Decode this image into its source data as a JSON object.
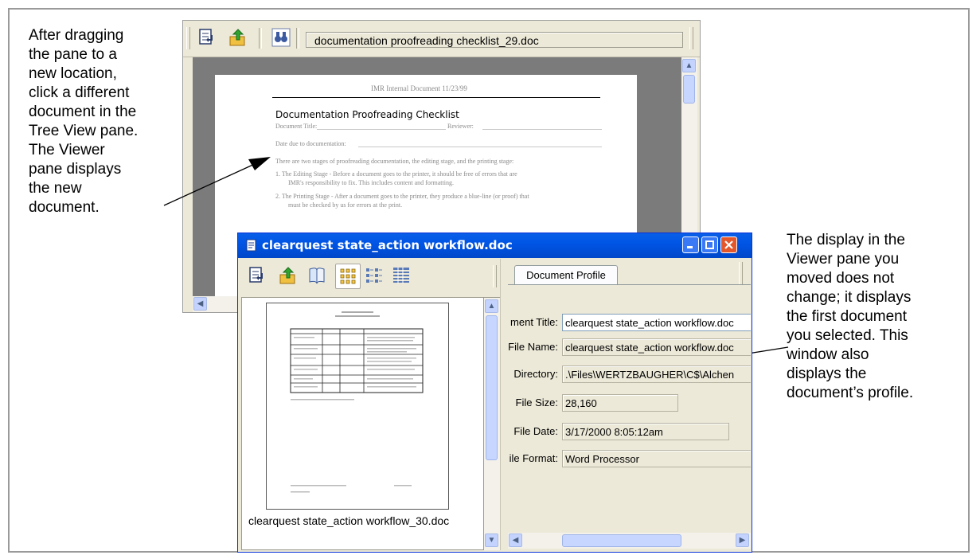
{
  "annotations": {
    "left_note": [
      "After dragging",
      "the pane to a",
      "new location,",
      "click a different",
      "document in the",
      "Tree View pane.",
      "The Viewer",
      "pane displays",
      "the new",
      "document."
    ],
    "right_note": [
      "The display in the",
      "Viewer pane you",
      "moved does not",
      "change; it displays",
      "the first document",
      "you selected. This",
      "window also",
      "displays the",
      "document’s profile."
    ]
  },
  "back_window": {
    "path": "documentation proofreading checklist_29.doc",
    "icons": [
      "tree-toggle-icon",
      "up-folder-icon",
      "find-binoculars-icon"
    ],
    "document": {
      "header": "IMR Internal Document 11/23/99",
      "title": "Documentation Proofreading Checklist",
      "doc_title_label": "Document Title:",
      "reviewer_label": "Reviewer:",
      "date_label": "Date due to documentation:",
      "intro": "There are two stages of proofreading documentation, the editing stage, and the printing stage:",
      "item1_a": "1.   The Editing Stage - Before a document goes to the printer, it should be free of errors that are",
      "item1_b": "IMR's responsibility to fix. This includes content and formatting.",
      "item2_a": "2.   The Printing Stage - After a document goes to the printer, they produce a blue-line (or proof) that",
      "item2_b": "must be checked by us for errors at the print."
    }
  },
  "front_window": {
    "title": "clearquest state_action workflow.doc",
    "filename": "clearquest state_action workflow_30.doc",
    "tab": "Document Profile",
    "profile": {
      "doc_title_label": "ment Title:",
      "doc_title_value": "clearquest state_action workflow.doc",
      "file_name_label": "File Name:",
      "file_name_value": "clearquest state_action workflow.doc",
      "directory_label": "Directory:",
      "directory_value": ".\\Files\\WERTZBAUGHER\\C$\\Alchen",
      "file_size_label": "File Size:",
      "file_size_value": "28,160",
      "file_date_label": "File Date:",
      "file_date_value": "3/17/2000 8:05:12am",
      "file_format_label": "ile Format:",
      "file_format_value": "Word Processor"
    },
    "preview_doc": {
      "heading_1": "IMR Internal Document",
      "heading_2": "Workflow State Action"
    }
  },
  "colors": {
    "titlebar": "#0055e5",
    "close_button": "#e3572b",
    "chrome": "#ece9d8",
    "scroll_thumb": "#c7d6fe"
  }
}
